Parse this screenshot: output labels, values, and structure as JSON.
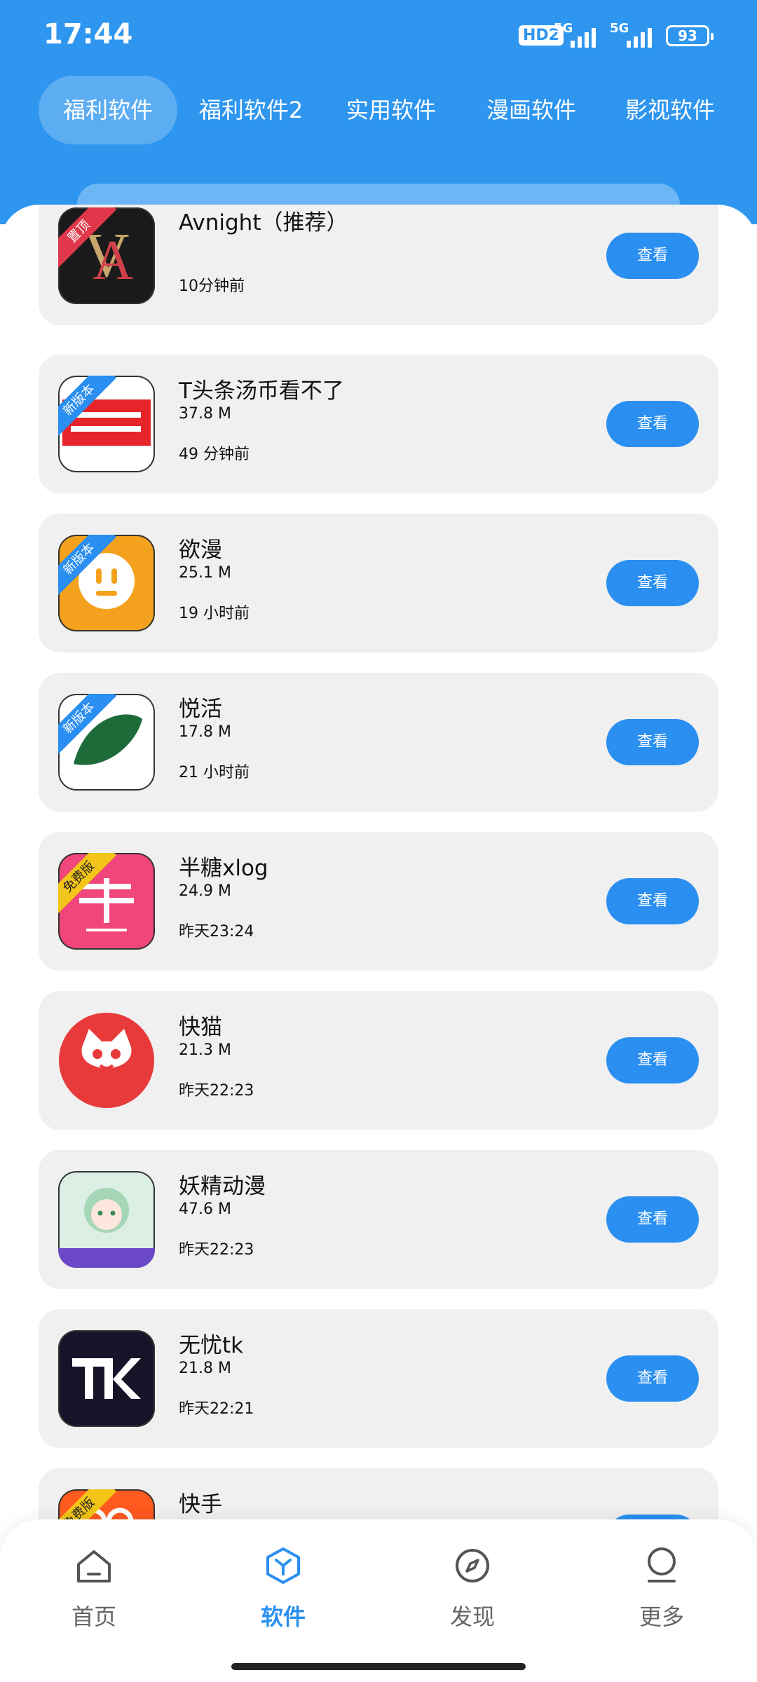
{
  "status_bar": {
    "time": "17:44",
    "hd": "HD2",
    "net1": "5G",
    "net2": "5G",
    "battery": "93"
  },
  "tabs": [
    {
      "label": "福利软件",
      "active": true
    },
    {
      "label": "福利软件2"
    },
    {
      "label": "实用软件"
    },
    {
      "label": "漫画软件"
    },
    {
      "label": "影视软件"
    }
  ],
  "apps": [
    {
      "name": "Avnight（推荐）",
      "size": "",
      "time": "10分钟前",
      "badge": "置顶",
      "button": "查看",
      "icon": "avnight-icon",
      "icon_color": "#1a1a1a"
    },
    {
      "name": "T头条汤币看不了",
      "size": "37.8 M",
      "time": "49 分钟前",
      "badge": "新版本",
      "button": "查看",
      "icon": "tangtoutiao-icon",
      "icon_color": "#e5252a"
    },
    {
      "name": "欲漫",
      "size": "25.1 M",
      "time": "19 小时前",
      "badge": "新版本",
      "button": "查看",
      "icon": "yuman-icon",
      "icon_color": "#f4a21e"
    },
    {
      "name": "悦活",
      "size": "17.8 M",
      "time": "21 小时前",
      "badge": "新版本",
      "button": "查看",
      "icon": "yuehuo-icon",
      "icon_color": "#ffffff"
    },
    {
      "name": "半糖xlog",
      "size": "24.9 M",
      "time": "昨天23:24",
      "badge": "免费版",
      "button": "查看",
      "icon": "bantang-icon",
      "icon_color": "#f0467a"
    },
    {
      "name": "快猫",
      "size": "21.3 M",
      "time": "昨天22:23",
      "badge": "",
      "button": "查看",
      "icon": "kuaimao-icon",
      "icon_color": "#e83a3a"
    },
    {
      "name": "妖精动漫",
      "size": "47.6 M",
      "time": "昨天22:23",
      "badge": "",
      "button": "查看",
      "icon": "yaojing-icon",
      "icon_color": "#a6d6b8"
    },
    {
      "name": "无忧tk",
      "size": "21.8 M",
      "time": "昨天22:21",
      "badge": "",
      "button": "查看",
      "icon": "wuyoutk-icon",
      "icon_color": "#17142a"
    },
    {
      "name": "快手",
      "size": "",
      "time": "",
      "badge": "免费版",
      "button": "查看",
      "icon": "kuaishou-icon",
      "icon_color": "#ff5a1f"
    }
  ],
  "bottom_nav": [
    {
      "label": "首页",
      "icon": "home-icon"
    },
    {
      "label": "软件",
      "icon": "software-icon",
      "active": true
    },
    {
      "label": "发现",
      "icon": "compass-icon"
    },
    {
      "label": "更多",
      "icon": "user-icon"
    }
  ],
  "colors": {
    "primary": "#2f96ef",
    "button": "#2a8ff0",
    "card_bg": "#f0f0f0"
  }
}
